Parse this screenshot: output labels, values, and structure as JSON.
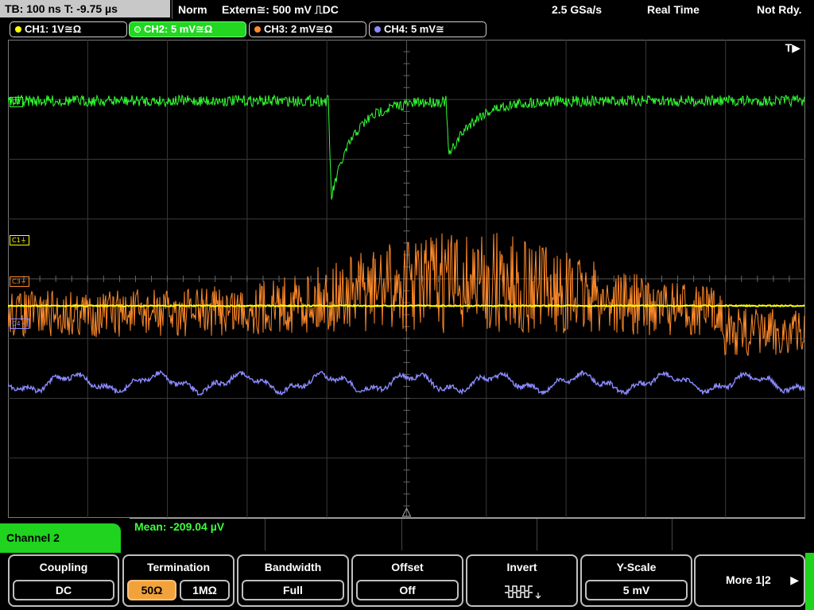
{
  "topbar": {
    "timebase": "TB: 100 ns   T: -9.75 µs",
    "mode": "Norm",
    "trigger": "Extern≅: 500 mV ⎍DC",
    "sample_rate": "2.5 GSa/s",
    "acq_mode": "Real Time",
    "status": "Not Rdy."
  },
  "channels": [
    {
      "label": "CH1: 1V≅Ω",
      "color": "#ffff00",
      "active": false
    },
    {
      "label": "CH2: 5 mV≅Ω",
      "color": "#33ff33",
      "active": true
    },
    {
      "label": "CH3: 2 mV≅Ω",
      "color": "#ff8a2a",
      "active": false
    },
    {
      "label": "CH4: 5 mV≅",
      "color": "#8a8aff",
      "active": false
    }
  ],
  "trigger_marker": "T▶",
  "markers": {
    "c2": "C2",
    "c1": "C1⏚",
    "c3": "C3⏚",
    "c4": "C4⏚"
  },
  "measurement": {
    "text": "Mean: -209.04 µV"
  },
  "channel_menu": {
    "title": "Channel 2"
  },
  "softkeys": {
    "coupling": {
      "title": "Coupling",
      "value": "DC"
    },
    "termination": {
      "title": "Termination",
      "opt1": "50Ω",
      "opt2": "1MΩ",
      "selected": "50Ω"
    },
    "bandwidth": {
      "title": "Bandwidth",
      "value": "Full"
    },
    "offset": {
      "title": "Offset",
      "value": "Off"
    },
    "invert": {
      "title": "Invert"
    },
    "yscale": {
      "title": "Y-Scale",
      "value": "5 mV"
    },
    "more": {
      "label": "More 1|2"
    }
  },
  "colors": {
    "ch1": "#ffff00",
    "ch2": "#33ff33",
    "ch3": "#ff8a2a",
    "ch4": "#8a8aff",
    "accent_green": "#1fd31f",
    "active_option": "#f2a23b"
  }
}
